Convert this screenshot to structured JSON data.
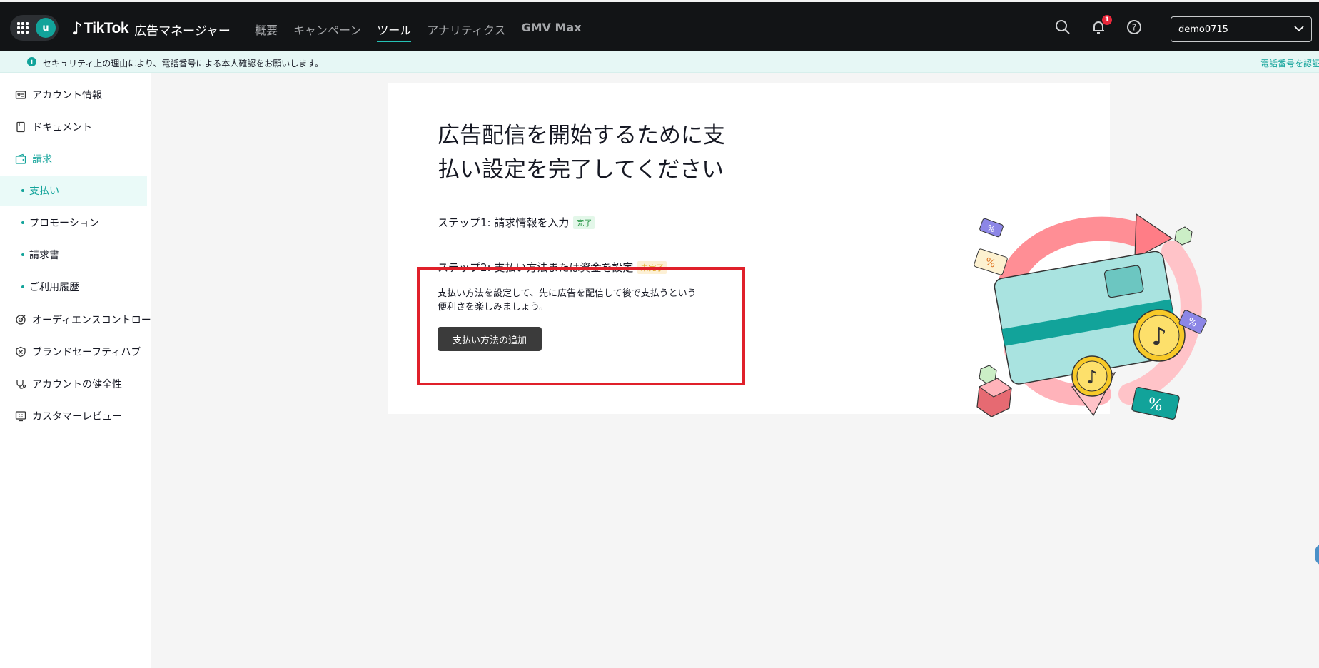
{
  "header": {
    "user_initial": "u",
    "brand": "TikTok",
    "product": "広告マネージャー",
    "nav": [
      "概要",
      "キャンペーン",
      "ツール",
      "アナリティクス",
      "GMV Max"
    ],
    "active_nav": "ツール",
    "notification_count": "1",
    "account_name": "demo0715"
  },
  "notice": {
    "message": "セキュリティ上の理由により、電話番号による本人確認をお願いします。",
    "link": "電話番号を認証"
  },
  "sidebar": {
    "items": [
      {
        "label": "アカウント情報",
        "icon": "id-card-icon"
      },
      {
        "label": "ドキュメント",
        "icon": "document-icon"
      },
      {
        "label": "請求",
        "icon": "wallet-icon"
      },
      {
        "label": "オーディエンスコントロール",
        "icon": "target-icon"
      },
      {
        "label": "ブランドセーフティハブ",
        "icon": "shield-icon"
      },
      {
        "label": "アカウントの健全性",
        "icon": "health-icon"
      },
      {
        "label": "カスタマーレビュー",
        "icon": "review-icon"
      }
    ],
    "billing_sub": [
      "支払い",
      "プロモーション",
      "請求書",
      "ご利用履歴"
    ],
    "active_sub": "支払い"
  },
  "main": {
    "headline": "広告配信を開始するために支払い設定を完了してください",
    "step1": "ステップ1: 請求情報を入力",
    "step1_status": "完了",
    "step2": "ステップ2: 支払い方法または資金を設定",
    "step2_status": "未完了",
    "description": "支払い方法を設定して、先に広告を配信して後で支払うという便利さを楽しみましょう。",
    "add_button": "支払い方法の追加"
  },
  "colors": {
    "accent": "#12a39a",
    "topbar": "#121416",
    "highlight_box": "#e0202a"
  }
}
